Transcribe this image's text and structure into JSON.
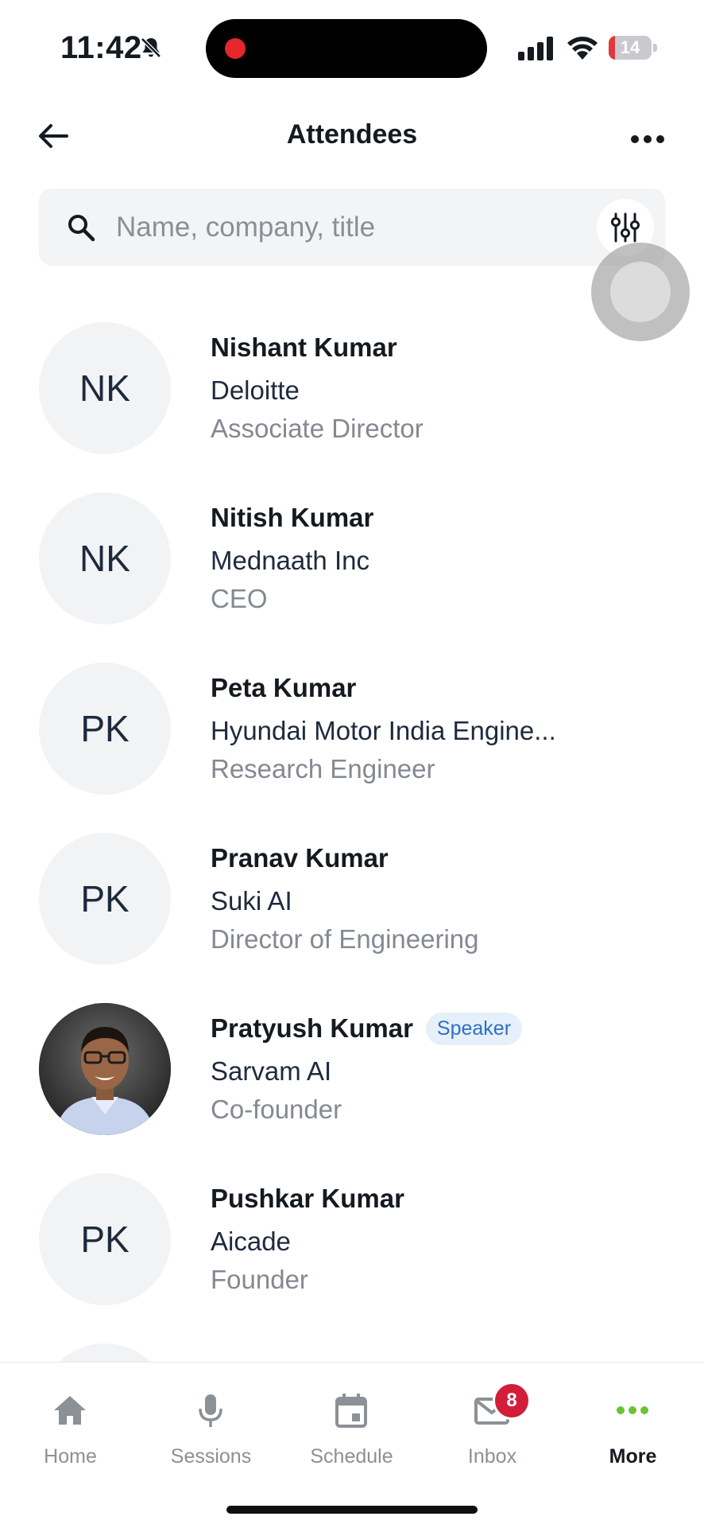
{
  "status_bar": {
    "time": "11:42",
    "battery": "14",
    "battery_level": 0.14,
    "colors": {
      "recording": "#e5262b",
      "battery_low": "#e0383e"
    },
    "icons": [
      "bell-slash-icon",
      "recording-dot-icon",
      "cellular-signal-icon",
      "wifi-icon",
      "battery-icon"
    ]
  },
  "header": {
    "title": "Attendees",
    "back_icon": "arrow-left-icon",
    "menu_icon": "more-horizontal-icon"
  },
  "search": {
    "placeholder": "Name, company, title",
    "value": "",
    "icon": "search-icon",
    "filter_icon": "sliders-icon"
  },
  "attendees": [
    {
      "initials": "NK",
      "name": "Nishant Kumar",
      "company": "Deloitte",
      "title": "Associate Director",
      "badge": ""
    },
    {
      "initials": "NK",
      "name": "Nitish Kumar",
      "company": "Mednaath Inc",
      "title": "CEO",
      "badge": ""
    },
    {
      "initials": "PK",
      "name": "Peta Kumar",
      "company": "Hyundai Motor India Engine...",
      "title": "Research Engineer",
      "badge": ""
    },
    {
      "initials": "PK",
      "name": "Pranav Kumar",
      "company": "Suki AI",
      "title": "Director of Engineering",
      "badge": ""
    },
    {
      "initials": "",
      "name": "Pratyush Kumar",
      "company": "Sarvam AI",
      "title": "Co-founder",
      "badge": "Speaker"
    },
    {
      "initials": "PK",
      "name": "Pushkar Kumar",
      "company": "Aicade",
      "title": "Founder",
      "badge": ""
    }
  ],
  "nav": {
    "items": [
      {
        "label": "Home",
        "icon": "home-icon"
      },
      {
        "label": "Sessions",
        "icon": "microphone-icon"
      },
      {
        "label": "Schedule",
        "icon": "calendar-icon"
      },
      {
        "label": "Inbox",
        "icon": "mail-icon"
      },
      {
        "label": "More",
        "icon": "more-dots-icon"
      }
    ],
    "active": "More",
    "inbox_badge": "8",
    "colors": {
      "active_icon": "#6cc332",
      "badge": "#d31e3a"
    }
  }
}
